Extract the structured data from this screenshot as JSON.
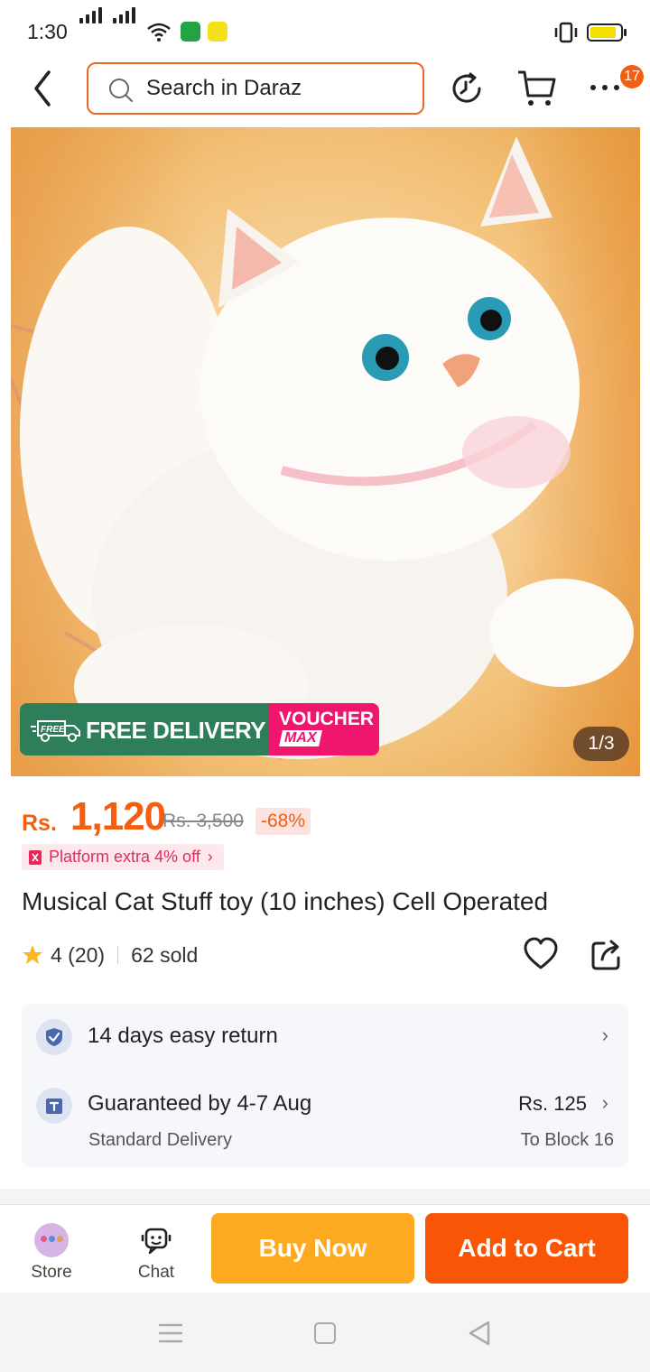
{
  "status_bar": {
    "time": "1:30"
  },
  "header": {
    "search_placeholder": "Search in Daraz",
    "notification_count": "17"
  },
  "product_image": {
    "promo_free_tag": "FREE",
    "promo_delivery": "FREE DELIVERY",
    "promo_voucher": "VOUCHER",
    "promo_max": "MAX",
    "image_counter": "1/3"
  },
  "price": {
    "currency": "Rs.",
    "current": "1,120",
    "original": "Rs. 3,500",
    "discount": "-68%",
    "platform_offer": "Platform extra 4% off"
  },
  "product": {
    "title": "Musical Cat Stuff toy (10 inches) Cell Operated",
    "rating": "4 (20)",
    "sold": "62 sold"
  },
  "services": {
    "return_policy": "14 days easy return",
    "guarantee": "Guaranteed by 4-7 Aug",
    "delivery_type": "Standard Delivery",
    "delivery_fee": "Rs. 125",
    "delivery_to": "To Block 16"
  },
  "bottom_bar": {
    "store_label": "Store",
    "chat_label": "Chat",
    "buy_now_label": "Buy Now",
    "add_to_cart_label": "Add to Cart"
  },
  "colors": {
    "accent": "#f55d11",
    "buy_now": "#fdaa21",
    "add_to_cart": "#f85606",
    "promo_green": "#2e7d5b",
    "promo_pink": "#f0166e"
  }
}
